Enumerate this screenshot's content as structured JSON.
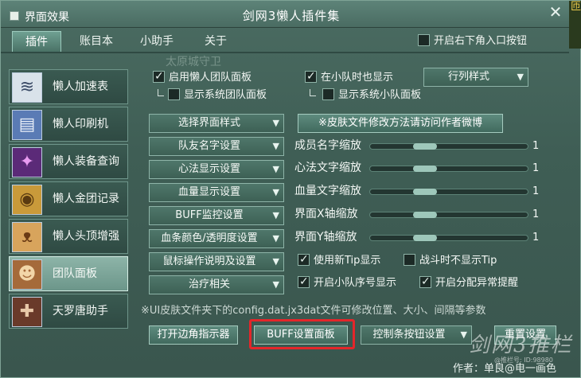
{
  "titlebar": {
    "left_label": "界面效果",
    "title": "剑网3懒人插件集",
    "close_glyph": "✕",
    "edge_glyphs": "匝"
  },
  "tabs": [
    {
      "label": "插件"
    },
    {
      "label": "账目本"
    },
    {
      "label": "小助手"
    },
    {
      "label": "关于"
    }
  ],
  "corner_toggle": {
    "label": "开启右下角入口按钮",
    "checked": false
  },
  "sidebar": {
    "items": [
      {
        "label": "懒人加速表",
        "icon": "wind-icon",
        "glyph": "≋"
      },
      {
        "label": "懒人印刷机",
        "icon": "book-icon",
        "glyph": "▤"
      },
      {
        "label": "懒人装备查询",
        "icon": "star-icon",
        "glyph": "✦"
      },
      {
        "label": "懒人金团记录",
        "icon": "coin-icon",
        "glyph": "◉"
      },
      {
        "label": "懒人头顶增强",
        "icon": "fox-icon",
        "glyph": "ᴥ"
      },
      {
        "label": "团队面板",
        "icon": "bear-icon",
        "glyph": "☻"
      },
      {
        "label": "天罗唐助手",
        "icon": "crossbow-icon",
        "glyph": "✚"
      }
    ]
  },
  "options": {
    "enable_team_panel": {
      "label": "启用懒人团队面板",
      "checked": true
    },
    "show_in_small_team": {
      "label": "在小队时也显示",
      "checked": true
    },
    "show_system_team": {
      "label": "显示系统团队面板",
      "checked": false
    },
    "show_system_small": {
      "label": "显示系统小队面板",
      "checked": false
    },
    "layout_select": "行列样式",
    "background_text": "太原城守卫"
  },
  "left_dropdowns": [
    "选择界面样式",
    "队友名字设置",
    "心法显示设置",
    "血量显示设置",
    "BUFF监控设置",
    "血条颜色/透明度设置",
    "鼠标操作说明及设置",
    "治疗相关"
  ],
  "skin_button": "※皮肤文件修改方法请访问作者微博",
  "sliders": [
    {
      "label": "成员名字缩放",
      "value": "1"
    },
    {
      "label": "心法文字缩放",
      "value": "1"
    },
    {
      "label": "血量文字缩放",
      "value": "1"
    },
    {
      "label": "界面X轴缩放",
      "value": "1"
    },
    {
      "label": "界面Y轴缩放",
      "value": "1"
    }
  ],
  "toggles": {
    "new_tip": {
      "label": "使用新Tip显示",
      "checked": true
    },
    "no_tip_in_combat": {
      "label": "战斗时不显示Tip",
      "checked": false
    },
    "team_number": {
      "label": "开启小队序号显示",
      "checked": true
    },
    "alloc_warning": {
      "label": "开启分配异常提醒",
      "checked": true
    }
  },
  "note": "※UI皮肤文件夹下的config.dat.jx3dat文件可修改位置、大小、间隔等参数",
  "bottom": {
    "corner_indicator": "打开边角指示器",
    "buff_panel": "BUFF设置面板",
    "control_bar": "控制条按钮设置",
    "reset": "重置设置"
  },
  "footer": {
    "author": "作者：单良@电一画色",
    "watermark": "剑网3推栏",
    "watermark_small": "@推栏号: ID:98980"
  }
}
